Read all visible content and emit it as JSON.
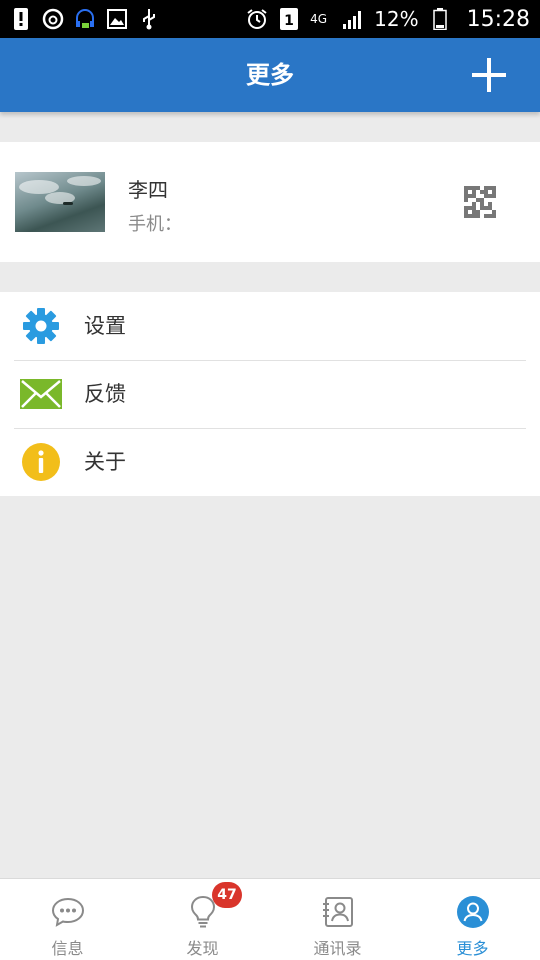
{
  "status_bar": {
    "icons_left": [
      "alert-icon",
      "netease-music-icon",
      "headset-icon",
      "image-icon",
      "usb-icon"
    ],
    "icons_right": [
      "alarm-icon",
      "sim-1-icon",
      "4g-icon",
      "signal-icon",
      "battery-icon"
    ],
    "network": "4G",
    "battery_percent": "12%",
    "time": "15:28"
  },
  "header": {
    "title": "更多",
    "add_icon": "plus-icon"
  },
  "profile": {
    "name": "李四",
    "phone_label": "手机：",
    "qr_icon": "qr-code-icon"
  },
  "menu": [
    {
      "label": "设置",
      "icon": "gear-icon",
      "color": "#2a9be0"
    },
    {
      "label": "反馈",
      "icon": "envelope-icon",
      "color": "#7ab82a"
    },
    {
      "label": "关于",
      "icon": "info-icon",
      "color": "#f2be1a"
    }
  ],
  "bottom_nav": {
    "items": [
      {
        "label": "信息",
        "icon": "chat-icon",
        "active": false
      },
      {
        "label": "发现",
        "icon": "lightbulb-icon",
        "active": false
      },
      {
        "label": "通讯录",
        "icon": "contacts-icon",
        "active": false
      },
      {
        "label": "更多",
        "icon": "person-icon",
        "active": true
      }
    ],
    "discover_badge": "47"
  },
  "colors": {
    "primary": "#2a76c6",
    "active_tab": "#2a8fd6",
    "badge": "#d9352b"
  }
}
